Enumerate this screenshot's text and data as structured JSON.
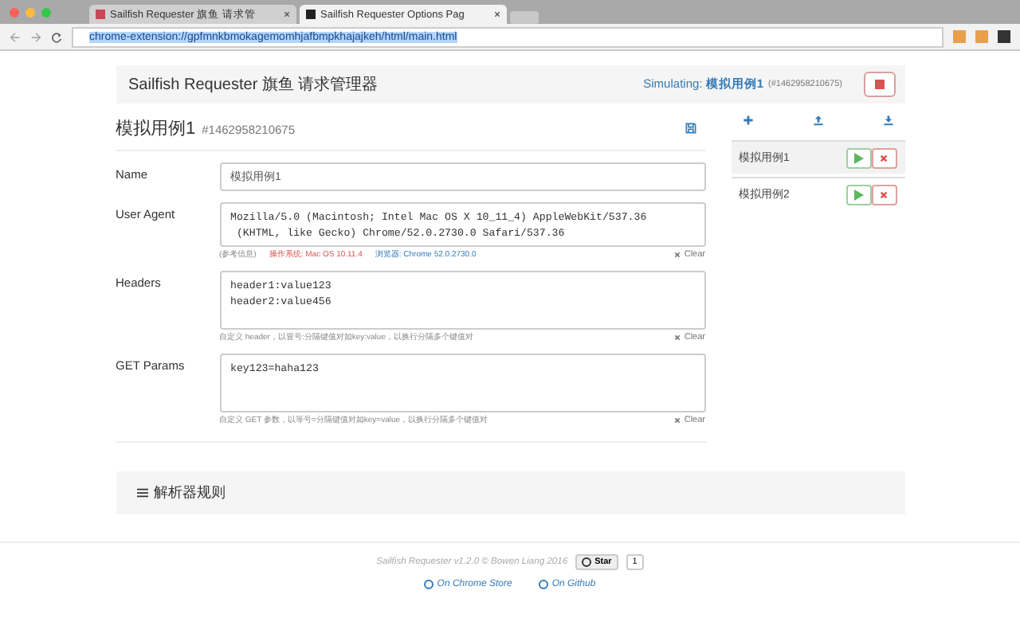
{
  "browser": {
    "tabs": [
      {
        "title": "Sailfish Requester 旗鱼 请求管",
        "selected": false
      },
      {
        "title": "Sailfish Requester Options Pag",
        "selected": true
      }
    ],
    "url": "chrome-extension://gpfmnkbmokagemomhjafbmpkhajajkeh/html/main.html"
  },
  "header": {
    "title": "Sailfish Requester 旗鱼 请求管理器",
    "simulating_label": "Simulating:",
    "simulating_name": "模拟用例1",
    "simulating_id": "(#1462958210675)"
  },
  "editor": {
    "title": "模拟用例1",
    "id": "#1462958210675",
    "fields": [
      {
        "label": "Name",
        "kind": "input",
        "value": "模拟用例1"
      },
      {
        "label": "User Agent",
        "kind": "textarea",
        "lines": [
          "Mozilla/5.0 (Macintosh; Intel Mac OS X 10_11_4) AppleWebKit/537.36",
          " (KHTML, like Gecko) Chrome/52.0.2730.0 Safari/537.36"
        ],
        "help": [
          {
            "text": "(参考信息)",
            "kind": "note"
          },
          {
            "text": "操作系统: Mac OS 10.11.4",
            "kind": "os"
          },
          {
            "text": "浏览器: Chrome 52.0.2730.0",
            "kind": "browser"
          }
        ],
        "clear": "Clear"
      },
      {
        "label": "Headers",
        "kind": "textarea",
        "lines": [
          "header1:value123",
          "header2:value456"
        ],
        "help": [
          {
            "text": "自定义 header，以冒号:分隔键值对如key:value，以换行分隔多个键值对",
            "kind": "note"
          }
        ],
        "clear": "Clear"
      },
      {
        "label": "GET Params",
        "kind": "textarea",
        "lines": [
          "key123=haha123"
        ],
        "help": [
          {
            "text": "自定义 GET 参数，以等号=分隔键值对如key=value，以换行分隔多个键值对",
            "kind": "note"
          }
        ],
        "clear": "Clear"
      }
    ]
  },
  "cases": [
    {
      "name": "模拟用例1",
      "selected": true
    },
    {
      "name": "模拟用例2",
      "selected": false
    }
  ],
  "section": {
    "title": "解析器规则"
  },
  "footer": {
    "credit": "Sailfish Requester v1.2.0 © Bowen Liang 2016",
    "star": "Star",
    "star_count": "1",
    "links": [
      "On Chrome Store",
      "On Github"
    ]
  }
}
